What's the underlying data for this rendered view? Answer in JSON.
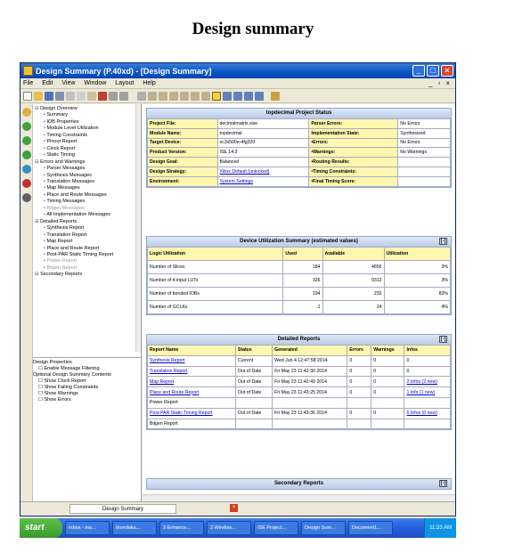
{
  "heading": "Design summary",
  "window": {
    "title": "Design Summary (P.40xd) - [Design Summary]"
  },
  "menu": [
    "File",
    "Edit",
    "View",
    "Window",
    "Layout",
    "Help"
  ],
  "tree": [
    {
      "t": "g",
      "label": "Design Overview"
    },
    {
      "t": "i",
      "label": "Summary"
    },
    {
      "t": "i",
      "label": "IOB Properties"
    },
    {
      "t": "i",
      "label": "Module Level Utilization"
    },
    {
      "t": "i",
      "label": "Timing Constraints"
    },
    {
      "t": "i",
      "label": "Pinout Report"
    },
    {
      "t": "i",
      "label": "Clock Report"
    },
    {
      "t": "i",
      "label": "Static Timing"
    },
    {
      "t": "g",
      "label": "Errors and Warnings"
    },
    {
      "t": "i",
      "label": "Parser Messages"
    },
    {
      "t": "i",
      "label": "Synthesis Messages"
    },
    {
      "t": "i",
      "label": "Translation Messages"
    },
    {
      "t": "i",
      "label": "Map Messages"
    },
    {
      "t": "i",
      "label": "Place and Route Messages"
    },
    {
      "t": "i",
      "label": "Timing Messages"
    },
    {
      "t": "d",
      "label": "Bitgen Messages"
    },
    {
      "t": "i",
      "label": "All Implementation Messages"
    },
    {
      "t": "g",
      "label": "Detailed Reports"
    },
    {
      "t": "i",
      "label": "Synthesis Report"
    },
    {
      "t": "i",
      "label": "Translation Report"
    },
    {
      "t": "i",
      "label": "Map Report"
    },
    {
      "t": "i",
      "label": "Place and Route Report"
    },
    {
      "t": "i",
      "label": "Post-PAR Static Timing Report"
    },
    {
      "t": "d",
      "label": "Power Report"
    },
    {
      "t": "d",
      "label": "Bitgen Report"
    },
    {
      "t": "g",
      "label": "Secondary Reports"
    }
  ],
  "props": {
    "title": "Design Properties",
    "enable": "Enable Message Filtering",
    "optional": "Optional Design Summary Contents",
    "items": [
      "Show Clock Report",
      "Show Failing Constraints",
      "Show Warnings",
      "Show Errors"
    ]
  },
  "status": {
    "title": "topdecimal Project Status",
    "rows": [
      [
        "Project File:",
        "decimalmatrix.xise",
        "Parser Errors:",
        "No Errors"
      ],
      [
        "Module Name:",
        "topdecimal",
        "Implementation State:",
        "Synthesized"
      ],
      [
        "Target Device:",
        "xc3s500e-4fg320",
        "•Errors:",
        "No Errors"
      ],
      [
        "Product Version:",
        "ISE 14.3",
        "•Warnings:",
        "No Warnings"
      ],
      [
        "Design Goal:",
        "Balanced",
        "•Routing Results:",
        ""
      ],
      [
        "Design Strategy:",
        "Xilinx Default (unlocked)",
        "•Timing Constraints:",
        ""
      ],
      [
        "Environment:",
        "System Settings",
        "•Final Timing Score:",
        ""
      ]
    ]
  },
  "util": {
    "title": "Device Utilization Summary (estimated values)",
    "headers": [
      "Logic Utilization",
      "Used",
      "Available",
      "Utilization"
    ],
    "rows": [
      [
        "Number of Slices",
        "184",
        "4656",
        "3%"
      ],
      [
        "Number of 4 input LUTs",
        "326",
        "9312",
        "3%"
      ],
      [
        "Number of bonded IOBs",
        "194",
        "232",
        "83%"
      ],
      [
        "Number of GCLKs",
        "1",
        "24",
        "4%"
      ]
    ]
  },
  "reports": {
    "title": "Detailed Reports",
    "headers": [
      "Report Name",
      "Status",
      "Generated",
      "Errors",
      "Warnings",
      "Infos"
    ],
    "rows": [
      [
        "Synthesis Report",
        "Current",
        "Wed Jun 4 12:47:58 2014",
        "0",
        "0",
        "0"
      ],
      [
        "Translation Report",
        "Out of Date",
        "Fri May 23 11:42:30 2014",
        "0",
        "0",
        "0"
      ],
      [
        "Map Report",
        "Out of Date",
        "Fri May 23 11:42:49 2014",
        "0",
        "0",
        "2 Infos (2 new)"
      ],
      [
        "Place and Route Report",
        "Out of Date",
        "Fri May 23 11:43:25 2014",
        "0",
        "0",
        "1 Info (1 new)"
      ],
      [
        "Power Report",
        "",
        "",
        "",
        "",
        ""
      ],
      [
        "Post-PAR Static Timing Report",
        "Out of Date",
        "Fri May 23 11:43:36 2014",
        "0",
        "0",
        "6 Infos (6 new)"
      ],
      [
        "Bitgen Report",
        "",
        "",
        "",
        "",
        ""
      ]
    ]
  },
  "secondary": {
    "title": "Secondary Reports"
  },
  "panel_btn": "[-]",
  "bottom_tab": "Design Summary",
  "taskbar": {
    "start": "start",
    "items": [
      "Inbox - ma...",
      "thondaka...",
      "3 Enhance...",
      "2 Window...",
      "ISE Project...",
      "Design Sum...",
      "Document1..."
    ],
    "clock": "11:23 AM"
  }
}
